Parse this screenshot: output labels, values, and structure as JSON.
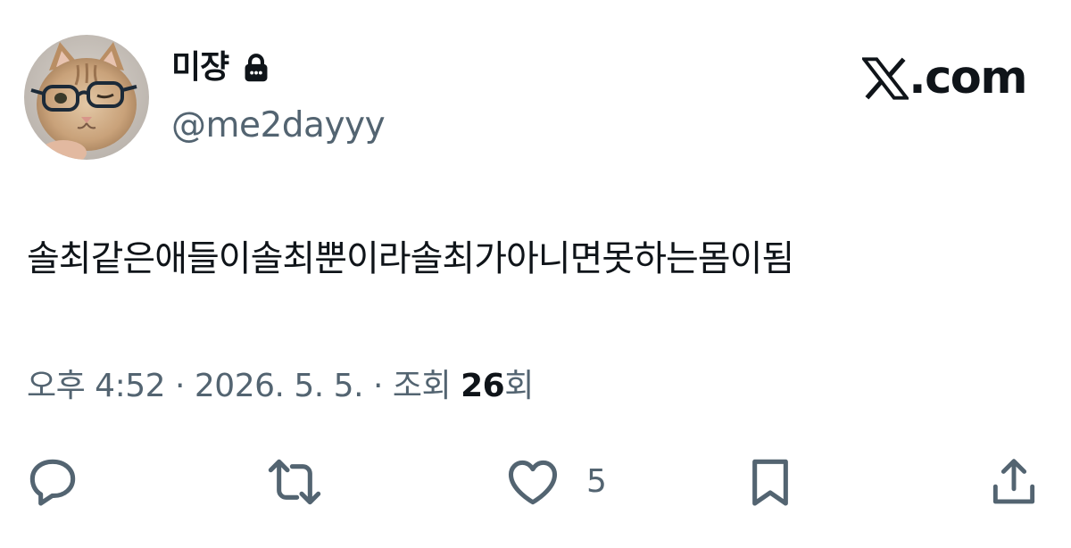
{
  "author": {
    "display_name": "미쟝",
    "handle": "@me2dayyy",
    "protected": true
  },
  "brand": {
    "logo_icon": "x-logo-icon",
    "text": ".com"
  },
  "tweet": {
    "text": "솔최같은애들이솔최뿐이라솔최가아니면못하는몸이됨"
  },
  "meta": {
    "time": "오후 4:52",
    "separator": "·",
    "date": "2026. 5. 5.",
    "views_label": "조회",
    "views_count": "26",
    "views_suffix": "회"
  },
  "actions": {
    "reply_icon": "reply-icon",
    "retweet_icon": "retweet-icon",
    "like_icon": "heart-icon",
    "like_count": "5",
    "bookmark_icon": "bookmark-icon",
    "share_icon": "share-icon"
  },
  "colors": {
    "text_primary": "#0f1419",
    "text_secondary": "#536471",
    "background": "#ffffff"
  }
}
